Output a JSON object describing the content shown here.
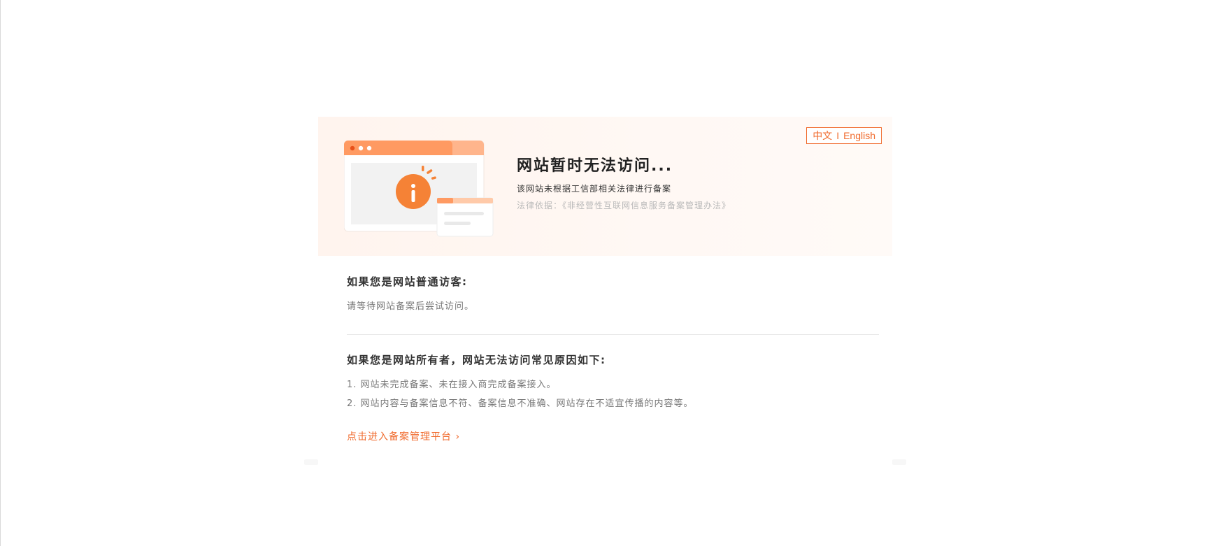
{
  "lang": {
    "zh": "中文",
    "sep": "I",
    "en": "English"
  },
  "banner": {
    "title": "网站暂时无法访问...",
    "subtitle": "该网站未根据工信部相关法律进行备案",
    "legal": "法律依据：《非经营性互联网信息服务备案管理办法》"
  },
  "visitor": {
    "heading": "如果您是网站普通访客:",
    "text": "请等待网站备案后尝试访问。"
  },
  "owner": {
    "heading": "如果您是网站所有者，网站无法访问常见原因如下:",
    "reasons": [
      "1. 网站未完成备案、未在接入商完成备案接入。",
      "2. 网站内容与备案信息不符、备案信息不准确、网站存在不适宜传播的内容等。"
    ]
  },
  "link": {
    "label": "点击进入备案管理平台 ›"
  },
  "colors": {
    "accent": "#f06a2c",
    "banner_bg": "#fff6f1"
  },
  "icons": {
    "illustration": "info-browser-illustration"
  }
}
